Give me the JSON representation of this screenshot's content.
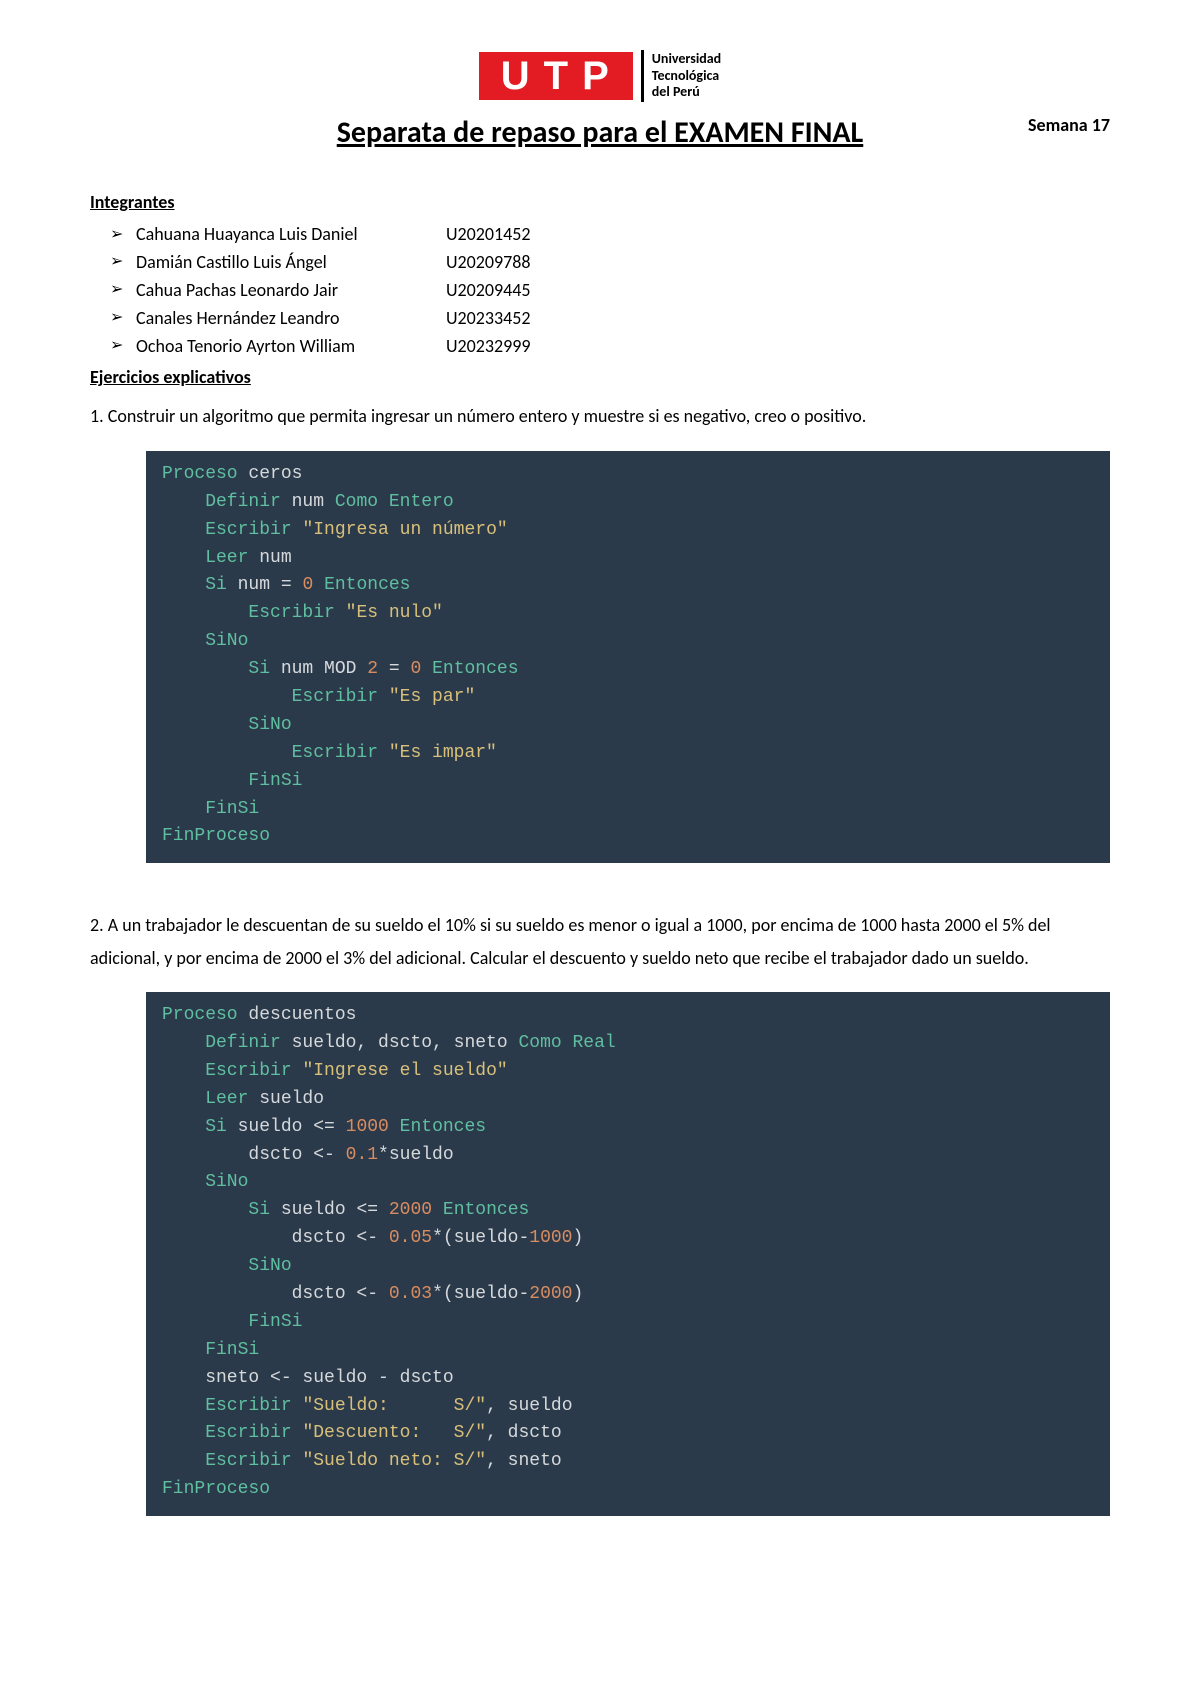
{
  "logo": {
    "letters": "UTP",
    "uni_line1": "Universidad",
    "uni_line2": "Tecnológica",
    "uni_line3": "del Perú"
  },
  "title": "Separata de repaso para el EXAMEN FINAL",
  "week": "Semana 17",
  "section_members": "Integrantes",
  "members": [
    {
      "name": "Cahuana Huayanca Luis Daniel",
      "code": "U20201452"
    },
    {
      "name": "Damián Castillo Luis Ángel",
      "code": "U20209788"
    },
    {
      "name": "Cahua Pachas Leonardo Jair",
      "code": "U20209445"
    },
    {
      "name": "Canales Hernández Leandro",
      "code": "U20233452"
    },
    {
      "name": "Ochoa Tenorio Ayrton William",
      "code": "U20232999"
    }
  ],
  "section_exercises": "Ejercicios explicativos",
  "ex1": {
    "num": "1.",
    "text": "Construir un algoritmo que permita ingresar un número entero y muestre si es negativo, creo o positivo.",
    "code": {
      "l1a": "Proceso",
      "l1b": " ceros",
      "l2a": "    Definir",
      "l2b": " num ",
      "l2c": "Como Entero",
      "l3a": "    Escribir ",
      "l3b": "\"Ingresa un número\"",
      "l4a": "    Leer",
      "l4b": " num",
      "l5a": "    Si",
      "l5b": " num = ",
      "l5c": "0",
      "l5d": " ",
      "l5e": "Entonces",
      "l6a": "        Escribir ",
      "l6b": "\"Es nulo\"",
      "l7a": "    SiNo",
      "l8a": "        Si",
      "l8b": " num MOD ",
      "l8c": "2",
      "l8d": " = ",
      "l8e": "0",
      "l8f": " ",
      "l8g": "Entonces",
      "l9a": "            Escribir ",
      "l9b": "\"Es par\"",
      "l10a": "        SiNo",
      "l11a": "            Escribir ",
      "l11b": "\"Es impar\"",
      "l12a": "        FinSi",
      "l13a": "    FinSi",
      "l14a": "FinProceso"
    }
  },
  "ex2": {
    "num": "2.",
    "text": "A un trabajador le descuentan de su sueldo el 10% si su sueldo es menor o igual a 1000, por encima de 1000 hasta 2000 el 5% del adicional, y por encima de 2000 el 3% del adicional. Calcular el descuento y sueldo neto que recibe el trabajador dado un sueldo.",
    "code": {
      "l1a": "Proceso",
      "l1b": " descuentos",
      "l2a": "    Definir",
      "l2b": " sueldo, dscto, sneto ",
      "l2c": "Como Real",
      "l3a": "    Escribir ",
      "l3b": "\"Ingrese el sueldo\"",
      "l4a": "    Leer",
      "l4b": " sueldo",
      "l5a": "    Si",
      "l5b": " sueldo <= ",
      "l5c": "1000",
      "l5d": " ",
      "l5e": "Entonces",
      "l6a": "        dscto <- ",
      "l6b": "0.1",
      "l6c": "*sueldo",
      "l7a": "    SiNo",
      "l8a": "        Si",
      "l8b": " sueldo <= ",
      "l8c": "2000",
      "l8d": " ",
      "l8e": "Entonces",
      "l9a": "            dscto <- ",
      "l9b": "0.05",
      "l9c": "*(sueldo-",
      "l9d": "1000",
      "l9e": ")",
      "l10a": "        SiNo",
      "l11a": "            dscto <- ",
      "l11b": "0.03",
      "l11c": "*(sueldo-",
      "l11d": "2000",
      "l11e": ")",
      "l12a": "        FinSi",
      "l13a": "    FinSi",
      "l14a": "    sneto <- sueldo - dscto",
      "l15a": "    Escribir ",
      "l15b": "\"Sueldo:      S/\"",
      "l15c": ", sueldo",
      "l16a": "    Escribir ",
      "l16b": "\"Descuento:   S/\"",
      "l16c": ", dscto",
      "l17a": "    Escribir ",
      "l17b": "\"Sueldo neto: S/\"",
      "l17c": ", sneto",
      "l18a": "FinProceso"
    }
  }
}
